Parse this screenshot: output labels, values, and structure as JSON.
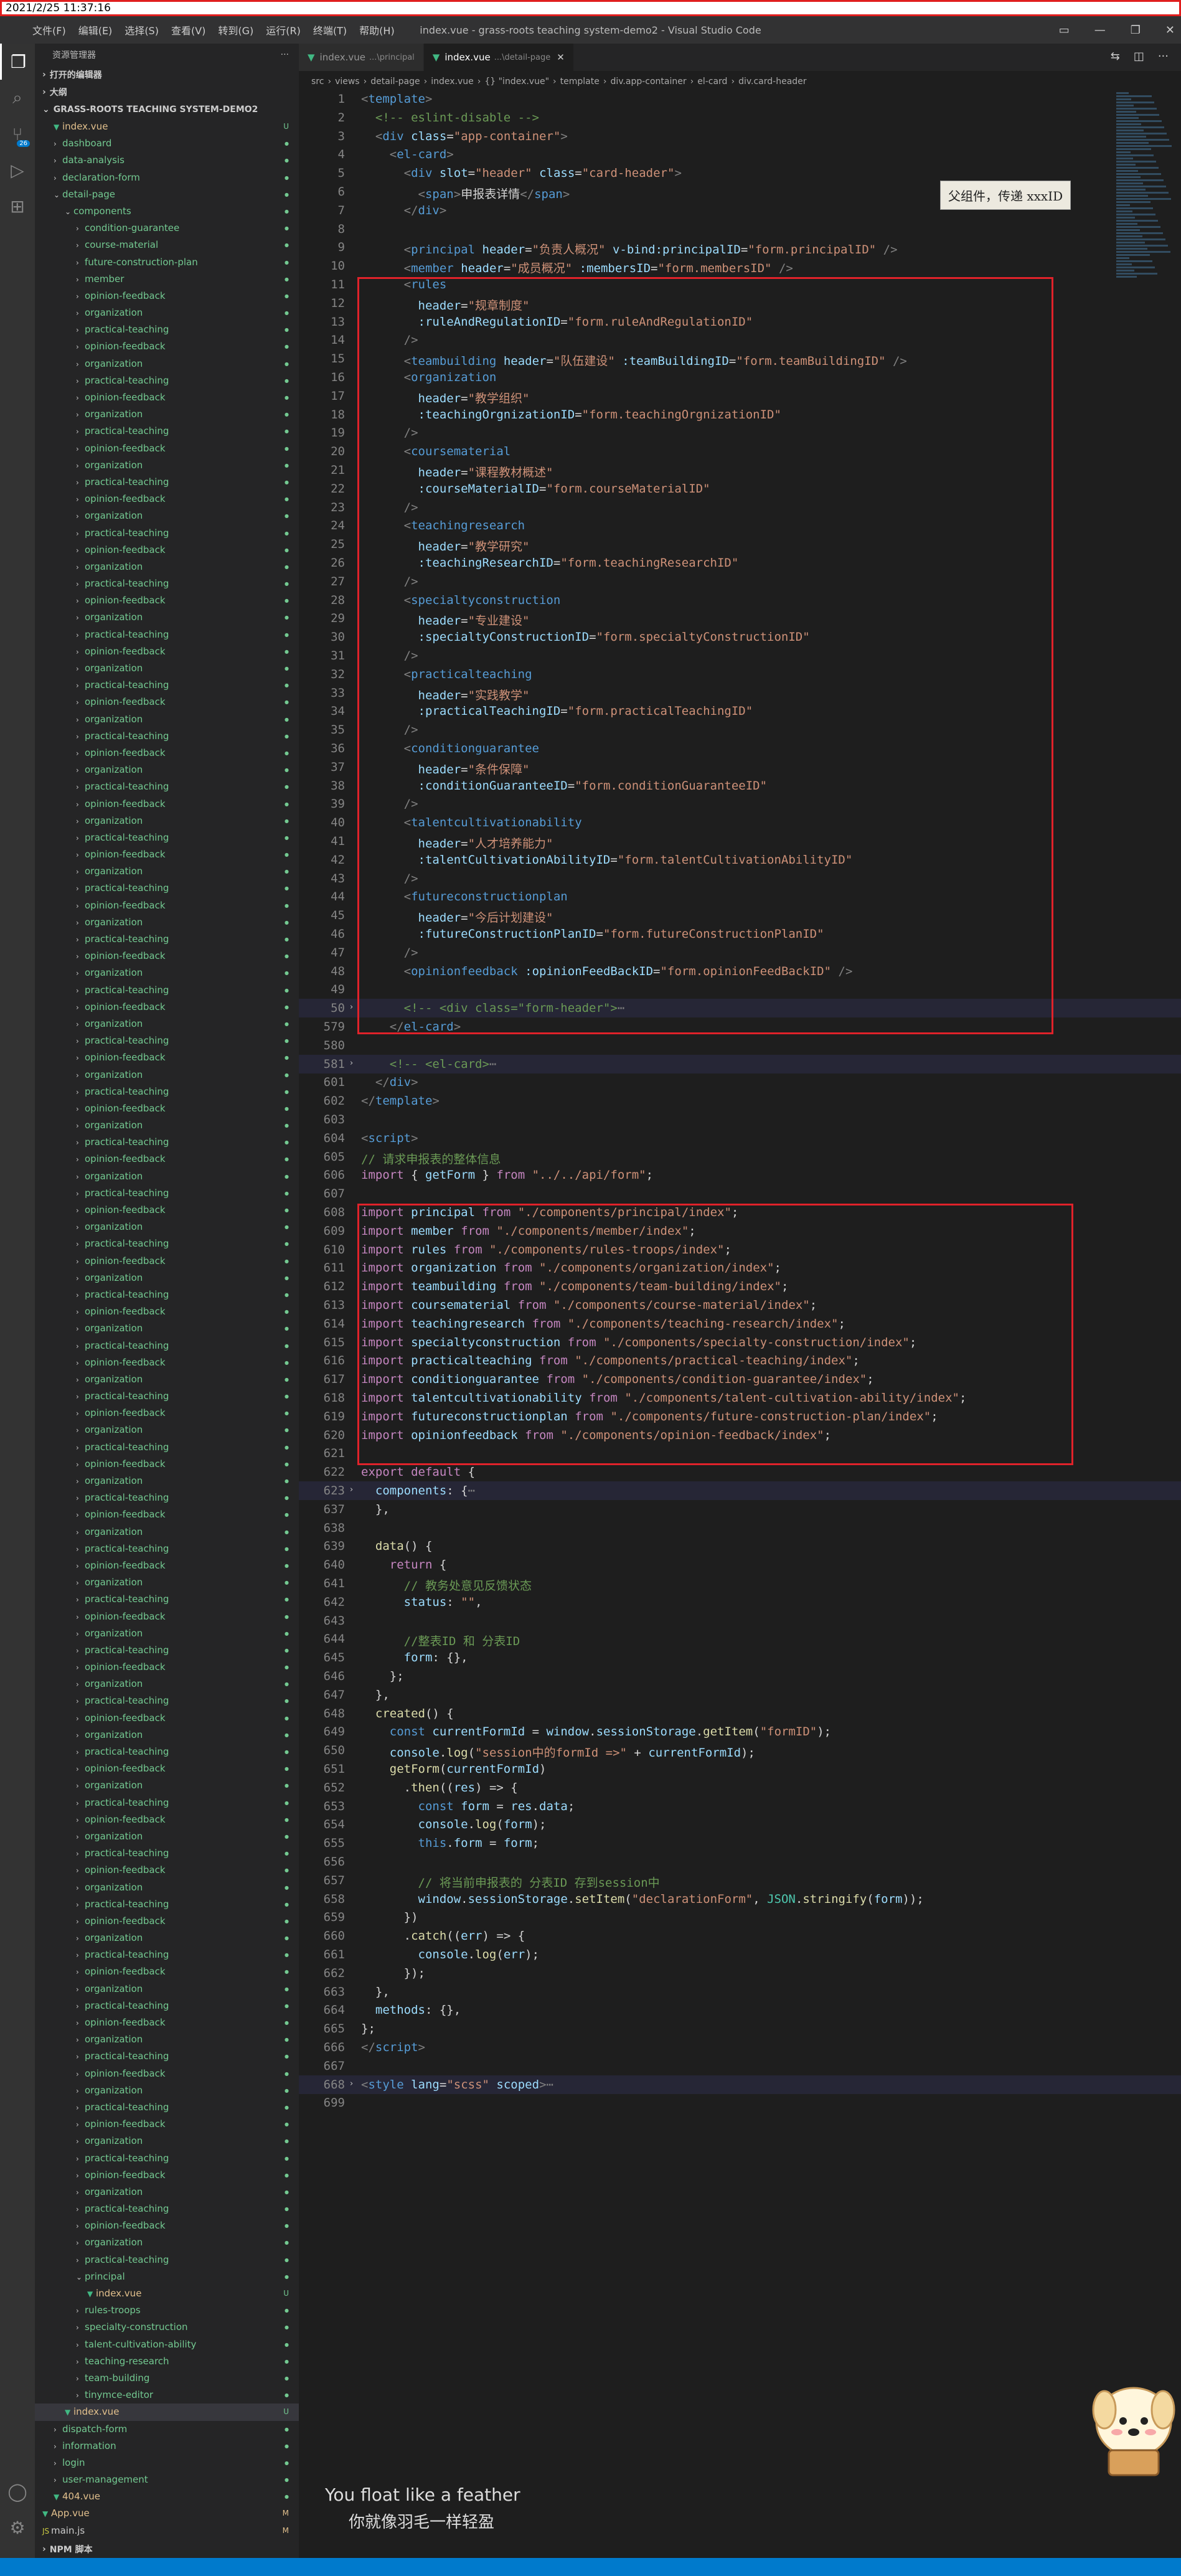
{
  "timestamp": "2021/2/25 11:37:16",
  "window": {
    "title": "index.vue - grass-roots teaching system-demo2 - Visual Studio Code",
    "menu": [
      "文件(F)",
      "编辑(E)",
      "选择(S)",
      "查看(V)",
      "转到(G)",
      "运行(R)",
      "终端(T)",
      "帮助(H)"
    ]
  },
  "activity_bar": [
    "files-icon",
    "search-icon",
    "source-control-icon",
    "run-debug-icon",
    "extensions-icon"
  ],
  "activity_badge": "26",
  "sidebar": {
    "header": "资源管理器",
    "sections": [
      "打开的编辑器",
      "大纲",
      "GRASS-ROOTS TEACHING SYSTEM-DEMO2"
    ],
    "tree_top": [
      {
        "name": "index.vue",
        "kind": "vue",
        "indent": 1,
        "badge": "U"
      },
      {
        "name": "dashboard",
        "kind": "folder",
        "indent": 1
      },
      {
        "name": "data-analysis",
        "kind": "folder",
        "indent": 1
      },
      {
        "name": "declaration-form",
        "kind": "folder",
        "indent": 1
      },
      {
        "name": "detail-page",
        "kind": "folder",
        "indent": 1,
        "open": true
      },
      {
        "name": "components",
        "kind": "folder",
        "indent": 2,
        "open": true
      },
      {
        "name": "condition-guarantee",
        "kind": "folder",
        "indent": 3
      },
      {
        "name": "course-material",
        "kind": "folder",
        "indent": 3
      },
      {
        "name": "future-construction-plan",
        "kind": "folder",
        "indent": 3
      },
      {
        "name": "member",
        "kind": "folder",
        "indent": 3
      },
      {
        "name": "opinion-feedback",
        "kind": "folder",
        "indent": 3
      },
      {
        "name": "organization",
        "kind": "folder",
        "indent": 3
      }
    ],
    "tree_repeat": [
      "practical-teaching",
      "opinion-feedback",
      "organization"
    ],
    "tree_bottom": [
      {
        "name": "practical-teaching",
        "kind": "folder",
        "indent": 3
      },
      {
        "name": "principal",
        "kind": "folder",
        "indent": 3,
        "open": true
      },
      {
        "name": "index.vue",
        "kind": "vue",
        "indent": 4,
        "badge": "U"
      },
      {
        "name": "rules-troops",
        "kind": "folder",
        "indent": 3
      },
      {
        "name": "specialty-construction",
        "kind": "folder",
        "indent": 3
      },
      {
        "name": "talent-cultivation-ability",
        "kind": "folder",
        "indent": 3
      },
      {
        "name": "teaching-research",
        "kind": "folder",
        "indent": 3
      },
      {
        "name": "team-building",
        "kind": "folder",
        "indent": 3
      },
      {
        "name": "tinymce-editor",
        "kind": "folder",
        "indent": 3
      },
      {
        "name": "index.vue",
        "kind": "vue",
        "indent": 2,
        "badge": "U",
        "selected": true
      },
      {
        "name": "dispatch-form",
        "kind": "folder",
        "indent": 1
      },
      {
        "name": "information",
        "kind": "folder",
        "indent": 1
      },
      {
        "name": "login",
        "kind": "folder",
        "indent": 1
      },
      {
        "name": "user-management",
        "kind": "folder",
        "indent": 1
      },
      {
        "name": "404.vue",
        "kind": "vue",
        "indent": 1
      },
      {
        "name": "App.vue",
        "kind": "vue",
        "indent": 0,
        "badge": "M"
      },
      {
        "name": "main.js",
        "kind": "plain",
        "indent": 0,
        "badge": "M"
      }
    ],
    "npm_scripts": "NPM 脚本"
  },
  "tabs": [
    {
      "label": "index.vue",
      "hint": "...\\principal",
      "active": false
    },
    {
      "label": "index.vue",
      "hint": "...\\detail-page",
      "active": true
    }
  ],
  "breadcrumb": [
    "src",
    "views",
    "detail-page",
    "index.vue",
    "{} \"index.vue\"",
    "template",
    "div.app-container",
    "el-card",
    "div.card-header"
  ],
  "tooltip": "父组件，传递 xxxID",
  "code": [
    {
      "n": "1",
      "h": "<span class='p'>&lt;</span><span class='t'>template</span><span class='p'>&gt;</span>"
    },
    {
      "n": "2",
      "h": "  <span class='c'>&lt;!-- eslint-disable --&gt;</span>"
    },
    {
      "n": "3",
      "h": "  <span class='p'>&lt;</span><span class='t'>div</span> <span class='a'>class</span>=<span class='s'>\"app-container\"</span><span class='p'>&gt;</span>"
    },
    {
      "n": "4",
      "h": "    <span class='p'>&lt;</span><span class='t'>el-card</span><span class='p'>&gt;</span>"
    },
    {
      "n": "5",
      "h": "      <span class='p'>&lt;</span><span class='t'>div</span> <span class='a'>slot</span>=<span class='s'>\"header\"</span> <span class='a'>class</span>=<span class='s'>\"card-header\"</span><span class='p'>&gt;</span>"
    },
    {
      "n": "6",
      "h": "        <span class='p'>&lt;</span><span class='t'>span</span><span class='p'>&gt;</span>申报表详情<span class='p'>&lt;/</span><span class='t'>span</span><span class='p'>&gt;</span>"
    },
    {
      "n": "7",
      "h": "      <span class='p'>&lt;/</span><span class='t'>div</span><span class='p'>&gt;</span>"
    },
    {
      "n": "8",
      "h": ""
    },
    {
      "n": "9",
      "h": "      <span class='p'>&lt;</span><span class='t'>principal</span> <span class='a'>header</span>=<span class='s'>\"负责人概况\"</span> <span class='a'>v-bind:principalID</span>=<span class='s'>\"form.principalID\"</span> <span class='p'>/&gt;</span>"
    },
    {
      "n": "10",
      "h": "      <span class='p'>&lt;</span><span class='t'>member</span> <span class='a'>header</span>=<span class='s'>\"成员概况\"</span> <span class='a'>:membersID</span>=<span class='s'>\"form.membersID\"</span> <span class='p'>/&gt;</span>"
    },
    {
      "n": "11",
      "h": "      <span class='p'>&lt;</span><span class='t'>rules</span>"
    },
    {
      "n": "12",
      "h": "        <span class='a'>header</span>=<span class='s'>\"规章制度\"</span>"
    },
    {
      "n": "13",
      "h": "        <span class='a'>:ruleAndRegulationID</span>=<span class='s'>\"form.ruleAndRegulationID\"</span>"
    },
    {
      "n": "14",
      "h": "      <span class='p'>/&gt;</span>"
    },
    {
      "n": "15",
      "h": "      <span class='p'>&lt;</span><span class='t'>teambuilding</span> <span class='a'>header</span>=<span class='s'>\"队伍建设\"</span> <span class='a'>:teamBuildingID</span>=<span class='s'>\"form.teamBuildingID\"</span> <span class='p'>/&gt;</span>"
    },
    {
      "n": "16",
      "h": "      <span class='p'>&lt;</span><span class='t'>organization</span>"
    },
    {
      "n": "17",
      "h": "        <span class='a'>header</span>=<span class='s'>\"教学组织\"</span>"
    },
    {
      "n": "18",
      "h": "        <span class='a'>:teachingOrgnizationID</span>=<span class='s'>\"form.teachingOrgnizationID\"</span>"
    },
    {
      "n": "19",
      "h": "      <span class='p'>/&gt;</span>"
    },
    {
      "n": "20",
      "h": "      <span class='p'>&lt;</span><span class='t'>coursematerial</span>"
    },
    {
      "n": "21",
      "h": "        <span class='a'>header</span>=<span class='s'>\"课程教材概述\"</span>"
    },
    {
      "n": "22",
      "h": "        <span class='a'>:courseMaterialID</span>=<span class='s'>\"form.courseMaterialID\"</span>"
    },
    {
      "n": "23",
      "h": "      <span class='p'>/&gt;</span>"
    },
    {
      "n": "24",
      "h": "      <span class='p'>&lt;</span><span class='t'>teachingresearch</span>"
    },
    {
      "n": "25",
      "h": "        <span class='a'>header</span>=<span class='s'>\"教学研究\"</span>"
    },
    {
      "n": "26",
      "h": "        <span class='a'>:teachingResearchID</span>=<span class='s'>\"form.teachingResearchID\"</span>"
    },
    {
      "n": "27",
      "h": "      <span class='p'>/&gt;</span>"
    },
    {
      "n": "28",
      "h": "      <span class='p'>&lt;</span><span class='t'>specialtyconstruction</span>"
    },
    {
      "n": "29",
      "h": "        <span class='a'>header</span>=<span class='s'>\"专业建设\"</span>"
    },
    {
      "n": "30",
      "h": "        <span class='a'>:specialtyConstructionID</span>=<span class='s'>\"form.specialtyConstructionID\"</span>"
    },
    {
      "n": "31",
      "h": "      <span class='p'>/&gt;</span>"
    },
    {
      "n": "32",
      "h": "      <span class='p'>&lt;</span><span class='t'>practicalteaching</span>"
    },
    {
      "n": "33",
      "h": "        <span class='a'>header</span>=<span class='s'>\"实践教学\"</span>"
    },
    {
      "n": "34",
      "h": "        <span class='a'>:practicalTeachingID</span>=<span class='s'>\"form.practicalTeachingID\"</span>"
    },
    {
      "n": "35",
      "h": "      <span class='p'>/&gt;</span>"
    },
    {
      "n": "36",
      "h": "      <span class='p'>&lt;</span><span class='t'>conditionguarantee</span>"
    },
    {
      "n": "37",
      "h": "        <span class='a'>header</span>=<span class='s'>\"条件保障\"</span>"
    },
    {
      "n": "38",
      "h": "        <span class='a'>:conditionGuaranteeID</span>=<span class='s'>\"form.conditionGuaranteeID\"</span>"
    },
    {
      "n": "39",
      "h": "      <span class='p'>/&gt;</span>"
    },
    {
      "n": "40",
      "h": "      <span class='p'>&lt;</span><span class='t'>talentcultivationability</span>"
    },
    {
      "n": "41",
      "h": "        <span class='a'>header</span>=<span class='s'>\"人才培养能力\"</span>"
    },
    {
      "n": "42",
      "h": "        <span class='a'>:talentCultivationAbilityID</span>=<span class='s'>\"form.talentCultivationAbilityID\"</span>"
    },
    {
      "n": "43",
      "h": "      <span class='p'>/&gt;</span>"
    },
    {
      "n": "44",
      "h": "      <span class='p'>&lt;</span><span class='t'>futureconstructionplan</span>"
    },
    {
      "n": "45",
      "h": "        <span class='a'>header</span>=<span class='s'>\"今后计划建设\"</span>"
    },
    {
      "n": "46",
      "h": "        <span class='a'>:futureConstructionPlanID</span>=<span class='s'>\"form.futureConstructionPlanID\"</span>"
    },
    {
      "n": "47",
      "h": "      <span class='p'>/&gt;</span>"
    },
    {
      "n": "48",
      "h": "      <span class='p'>&lt;</span><span class='t'>opinionfeedback</span> <span class='a'>:opinionFeedBackID</span>=<span class='s'>\"form.opinionFeedBackID\"</span> <span class='p'>/&gt;</span>"
    },
    {
      "n": "49",
      "h": ""
    },
    {
      "n": "50",
      "h": "      <span class='c'>&lt;!-- &lt;div class=\"form-header\"&gt;</span><span class='p'>⋯</span>",
      "fold": true
    },
    {
      "n": "579",
      "h": "    <span class='p'>&lt;/</span><span class='t'>el-card</span><span class='p'>&gt;</span>"
    },
    {
      "n": "580",
      "h": ""
    },
    {
      "n": "581",
      "h": "    <span class='c'>&lt;!-- &lt;el-card&gt;</span><span class='p'>⋯</span>",
      "fold": true
    },
    {
      "n": "601",
      "h": "  <span class='p'>&lt;/</span><span class='t'>div</span><span class='p'>&gt;</span>"
    },
    {
      "n": "602",
      "h": "<span class='p'>&lt;/</span><span class='t'>template</span><span class='p'>&gt;</span>"
    },
    {
      "n": "603",
      "h": ""
    },
    {
      "n": "604",
      "h": "<span class='p'>&lt;</span><span class='t'>script</span><span class='p'>&gt;</span>"
    },
    {
      "n": "605",
      "h": "<span class='c'>// 请求申报表的整体信息</span>"
    },
    {
      "n": "606",
      "h": "<span class='k'>import</span> { <span class='v'>getForm</span> } <span class='k'>from</span> <span class='s'>\"../../api/form\"</span>;"
    },
    {
      "n": "607",
      "h": ""
    },
    {
      "n": "608",
      "h": "<span class='k'>import</span> <span class='v'>principal</span> <span class='k'>from</span> <span class='s'>\"./components/principal/index\"</span>;"
    },
    {
      "n": "609",
      "h": "<span class='k'>import</span> <span class='v'>member</span> <span class='k'>from</span> <span class='s'>\"./components/member/index\"</span>;"
    },
    {
      "n": "610",
      "h": "<span class='k'>import</span> <span class='v'>rules</span> <span class='k'>from</span> <span class='s'>\"./components/rules-troops/index\"</span>;"
    },
    {
      "n": "611",
      "h": "<span class='k'>import</span> <span class='v'>organization</span> <span class='k'>from</span> <span class='s'>\"./components/organization/index\"</span>;"
    },
    {
      "n": "612",
      "h": "<span class='k'>import</span> <span class='v'>teambuilding</span> <span class='k'>from</span> <span class='s'>\"./components/team-building/index\"</span>;"
    },
    {
      "n": "613",
      "h": "<span class='k'>import</span> <span class='v'>coursematerial</span> <span class='k'>from</span> <span class='s'>\"./components/course-material/index\"</span>;"
    },
    {
      "n": "614",
      "h": "<span class='k'>import</span> <span class='v'>teachingresearch</span> <span class='k'>from</span> <span class='s'>\"./components/teaching-research/index\"</span>;"
    },
    {
      "n": "615",
      "h": "<span class='k'>import</span> <span class='v'>specialtyconstruction</span> <span class='k'>from</span> <span class='s'>\"./components/specialty-construction/index\"</span>;"
    },
    {
      "n": "616",
      "h": "<span class='k'>import</span> <span class='v'>practicalteaching</span> <span class='k'>from</span> <span class='s'>\"./components/practical-teaching/index\"</span>;"
    },
    {
      "n": "617",
      "h": "<span class='k'>import</span> <span class='v'>conditionguarantee</span> <span class='k'>from</span> <span class='s'>\"./components/condition-guarantee/index\"</span>;"
    },
    {
      "n": "618",
      "h": "<span class='k'>import</span> <span class='v'>talentcultivationability</span> <span class='k'>from</span> <span class='s'>\"./components/talent-cultivation-ability/index\"</span>;"
    },
    {
      "n": "619",
      "h": "<span class='k'>import</span> <span class='v'>futureconstructionplan</span> <span class='k'>from</span> <span class='s'>\"./components/future-construction-plan/index\"</span>;"
    },
    {
      "n": "620",
      "h": "<span class='k'>import</span> <span class='v'>opinionfeedback</span> <span class='k'>from</span> <span class='s'>\"./components/opinion-feedback/index\"</span>;"
    },
    {
      "n": "621",
      "h": ""
    },
    {
      "n": "622",
      "h": "<span class='k'>export</span> <span class='k'>default</span> {"
    },
    {
      "n": "623",
      "h": "  <span class='v'>components</span>: {<span class='p'>⋯</span>",
      "fold": true
    },
    {
      "n": "637",
      "h": "  },"
    },
    {
      "n": "638",
      "h": ""
    },
    {
      "n": "639",
      "h": "  <span class='f'>data</span>() {"
    },
    {
      "n": "640",
      "h": "    <span class='k'>return</span> {"
    },
    {
      "n": "641",
      "h": "      <span class='c'>// 教务处意见反馈状态</span>"
    },
    {
      "n": "642",
      "h": "      <span class='v'>status</span>: <span class='s'>\"\"</span>,"
    },
    {
      "n": "643",
      "h": ""
    },
    {
      "n": "644",
      "h": "      <span class='c'>//整表ID 和 分表ID</span>"
    },
    {
      "n": "645",
      "h": "      <span class='v'>form</span>: {},"
    },
    {
      "n": "646",
      "h": "    };"
    },
    {
      "n": "647",
      "h": "  },"
    },
    {
      "n": "648",
      "h": "  <span class='f'>created</span>() {"
    },
    {
      "n": "649",
      "h": "    <span class='kw'>const</span> <span class='v'>currentFormId</span> = <span class='v'>window</span>.<span class='v'>sessionStorage</span>.<span class='f'>getItem</span>(<span class='s'>\"formID\"</span>);"
    },
    {
      "n": "650",
      "h": "    <span class='v'>console</span>.<span class='f'>log</span>(<span class='s'>\"session中的formId =&gt;\"</span> + <span class='v'>currentFormId</span>);"
    },
    {
      "n": "651",
      "h": "    <span class='f'>getForm</span>(<span class='v'>currentFormId</span>)"
    },
    {
      "n": "652",
      "h": "      .<span class='f'>then</span>((<span class='v'>res</span>) =&gt; {"
    },
    {
      "n": "653",
      "h": "        <span class='kw'>const</span> <span class='v'>form</span> = <span class='v'>res</span>.<span class='v'>data</span>;"
    },
    {
      "n": "654",
      "h": "        <span class='v'>console</span>.<span class='f'>log</span>(<span class='v'>form</span>);"
    },
    {
      "n": "655",
      "h": "        <span class='kw'>this</span>.<span class='v'>form</span> = <span class='v'>form</span>;"
    },
    {
      "n": "656",
      "h": ""
    },
    {
      "n": "657",
      "h": "        <span class='c'>// 将当前申报表的 分表ID 存到session中</span>"
    },
    {
      "n": "658",
      "h": "        <span class='v'>window</span>.<span class='v'>sessionStorage</span>.<span class='f'>setItem</span>(<span class='s'>\"declarationForm\"</span>, <span class='b'>JSON</span>.<span class='f'>stringify</span>(<span class='v'>form</span>));"
    },
    {
      "n": "659",
      "h": "      })"
    },
    {
      "n": "660",
      "h": "      .<span class='f'>catch</span>((<span class='v'>err</span>) =&gt; {"
    },
    {
      "n": "661",
      "h": "        <span class='v'>console</span>.<span class='f'>log</span>(<span class='v'>err</span>);"
    },
    {
      "n": "662",
      "h": "      });"
    },
    {
      "n": "663",
      "h": "  },"
    },
    {
      "n": "664",
      "h": "  <span class='v'>methods</span>: {},"
    },
    {
      "n": "665",
      "h": "};"
    },
    {
      "n": "666",
      "h": "<span class='p'>&lt;/</span><span class='t'>script</span><span class='p'>&gt;</span>"
    },
    {
      "n": "667",
      "h": ""
    },
    {
      "n": "668",
      "h": "<span class='p'>&lt;</span><span class='t'>style</span> <span class='a'>lang</span>=<span class='s'>\"scss\"</span> <span class='a'>scoped</span><span class='p'>&gt;</span><span class='p'>⋯</span>",
      "fold": true
    },
    {
      "n": "699",
      "h": ""
    }
  ],
  "lyrics": {
    "en": "You float like a feather",
    "zh": "你就像羽毛一样轻盈"
  },
  "colors": {
    "highlight_box": "#e0222a",
    "status_bar": "#007acc",
    "editor_bg": "#1e1e1e",
    "sidebar_bg": "#252526"
  }
}
